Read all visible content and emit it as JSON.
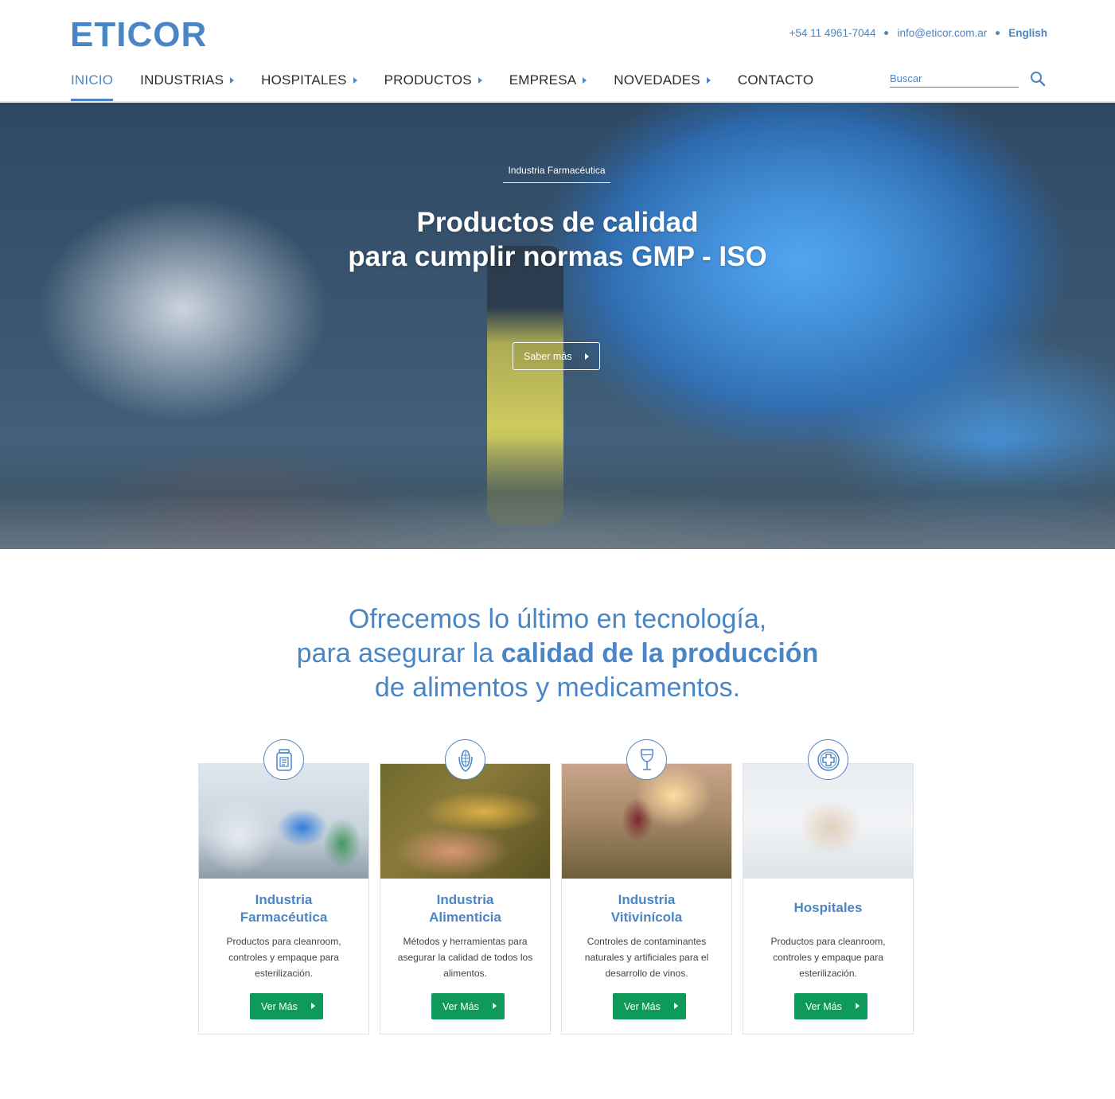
{
  "brand": {
    "logo": "ETICOR",
    "color": "#4a86c5",
    "accent_green": "#0e9a5b"
  },
  "contact": {
    "phone": "+54 11 4961-7044",
    "email": "info@eticor.com.ar",
    "language": "English"
  },
  "nav": {
    "items": [
      {
        "label": "INICIO",
        "active": true,
        "has_submenu": false
      },
      {
        "label": "INDUSTRIAS",
        "active": false,
        "has_submenu": true
      },
      {
        "label": "HOSPITALES",
        "active": false,
        "has_submenu": true
      },
      {
        "label": "PRODUCTOS",
        "active": false,
        "has_submenu": true
      },
      {
        "label": "EMPRESA",
        "active": false,
        "has_submenu": true
      },
      {
        "label": "NOVEDADES",
        "active": false,
        "has_submenu": true
      },
      {
        "label": "CONTACTO",
        "active": false,
        "has_submenu": false
      }
    ],
    "search_placeholder": "Buscar",
    "search_icon": "search-icon"
  },
  "hero": {
    "tag": "Industria Farmacéutica",
    "title_line1": "Productos de calidad",
    "title_line2": "para cumplir normas GMP - ISO",
    "button": "Saber más"
  },
  "intro": {
    "line1": "Ofrecemos lo último en tecnología,",
    "line2_prefix": "para asegurar la ",
    "line2_bold": "calidad de la producción",
    "line3": "de alimentos y medicamentos."
  },
  "cards": [
    {
      "icon": "medicine-bottle-icon",
      "title_line1": "Industria",
      "title_line2": "Farmacéutica",
      "description": "Productos para cleanroom, controles y empaque para esterilización.",
      "button": "Ver Más"
    },
    {
      "icon": "corn-icon",
      "title_line1": "Industria",
      "title_line2": "Alimenticia",
      "description": "Métodos y herramientas para asegurar la calidad de todos los alimentos.",
      "button": "Ver Más"
    },
    {
      "icon": "wine-glass-icon",
      "title_line1": "Industria",
      "title_line2": "Vitivinícola",
      "description": "Controles de contaminantes naturales y artificiales para el desarrollo de vinos.",
      "button": "Ver Más"
    },
    {
      "icon": "medical-cross-icon",
      "title_line1": "Hospitales",
      "title_line2": "",
      "description": "Productos para cleanroom, controles y empaque para esterilización.",
      "button": "Ver Más"
    }
  ]
}
